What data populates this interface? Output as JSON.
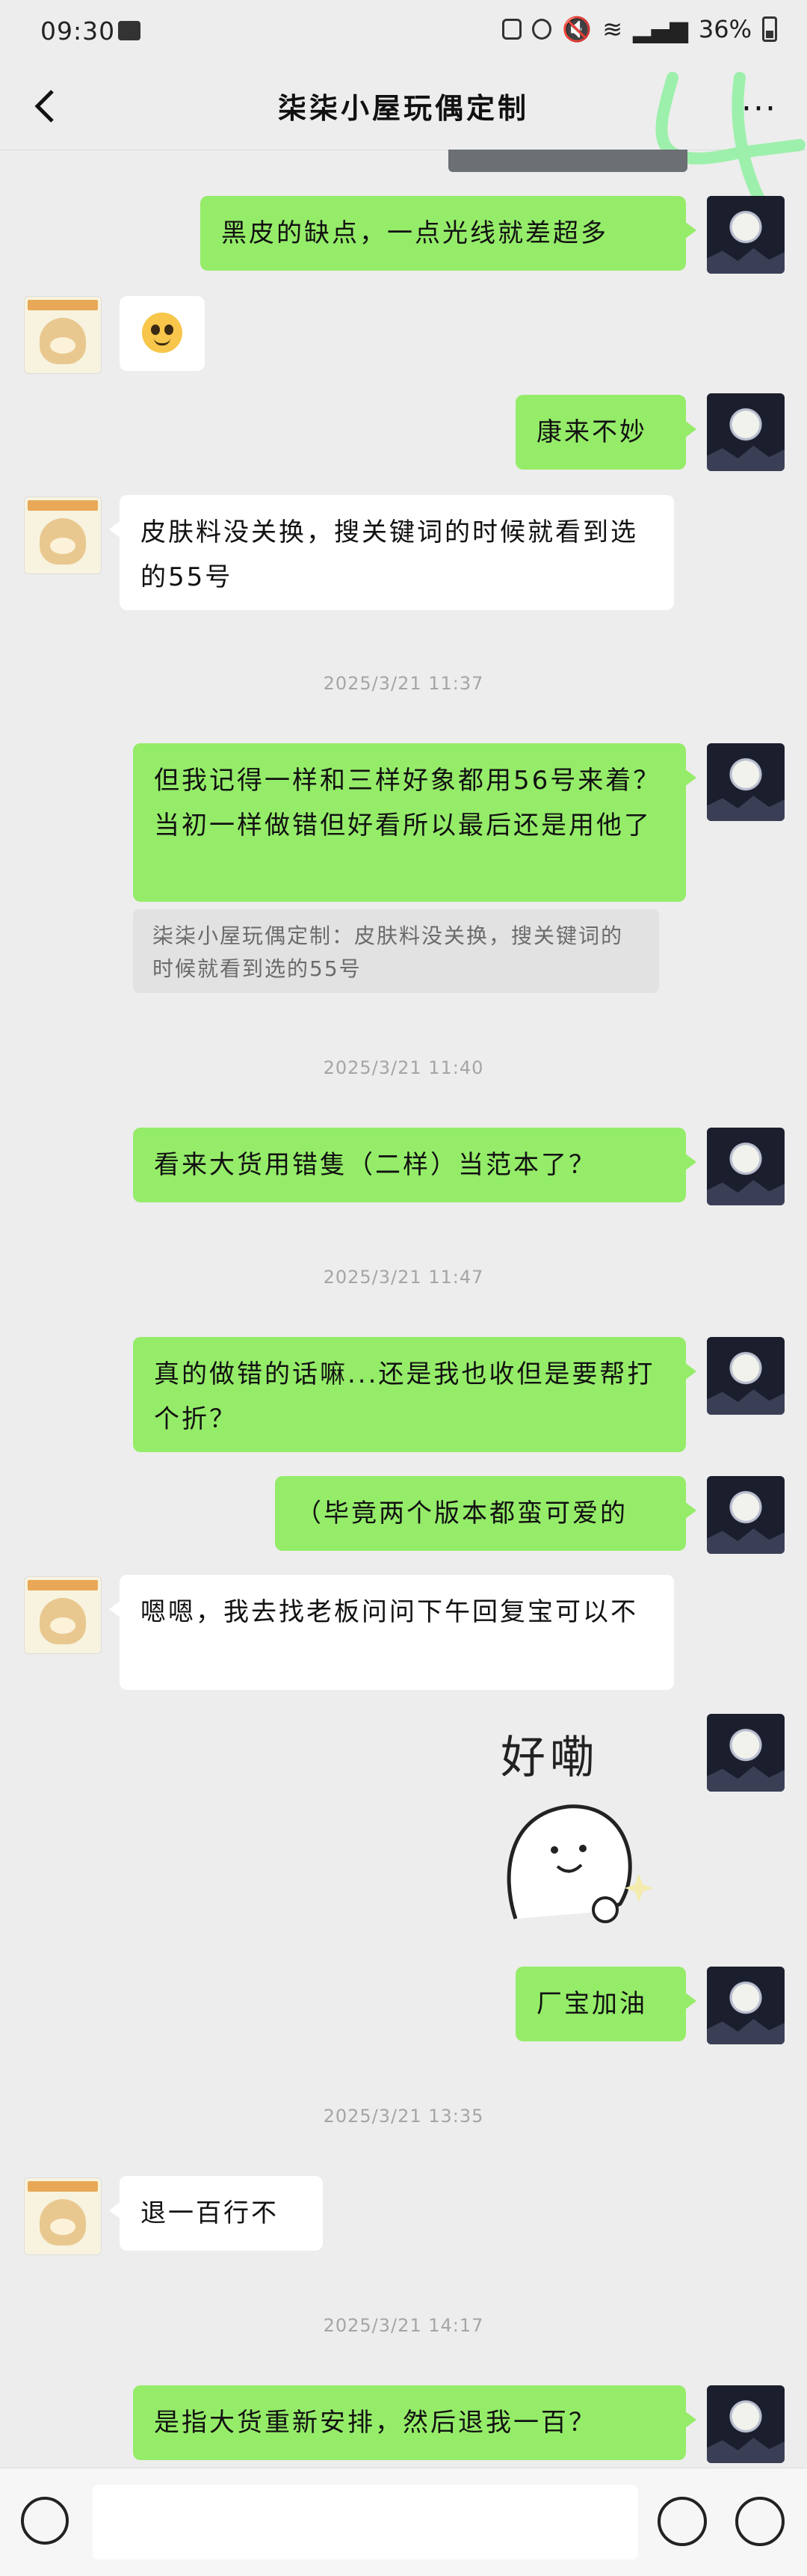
{
  "status": {
    "time": "09:30",
    "battery": "36%"
  },
  "header": {
    "title": "柒柒小屋玩偶定制",
    "more": "···"
  },
  "messages": {
    "m1": "黑皮的缺点，一点光线就差超多",
    "m3": "康来不妙",
    "m4": "皮肤料没关换，搜关键词的时候就看到选的55号",
    "ts1": "2025/3/21 11:37",
    "m5": "但我记得一样和三样好象都用56号来着？当初一样做错但好看所以最后还是用他了",
    "q5": "柒柒小屋玩偶定制：皮肤料没关换，搜关键词的时候就看到选的55号",
    "ts2": "2025/3/21 11:40",
    "m6": "看来大货用错隻（二样）当范本了？",
    "ts3": "2025/3/21 11:47",
    "m7": "真的做错的话嘛...还是我也收但是要帮打个折？",
    "m8": "（毕竟两个版本都蛮可爱的",
    "m9": "嗯嗯，我去找老板问问下午回复宝可以不",
    "sticker": "好嘞",
    "m10": "厂宝加油",
    "ts4": "2025/3/21 13:35",
    "m11": "退一百行不",
    "ts5": "2025/3/21 14:17",
    "m12": "是指大货重新安排，然后退我一百？"
  }
}
